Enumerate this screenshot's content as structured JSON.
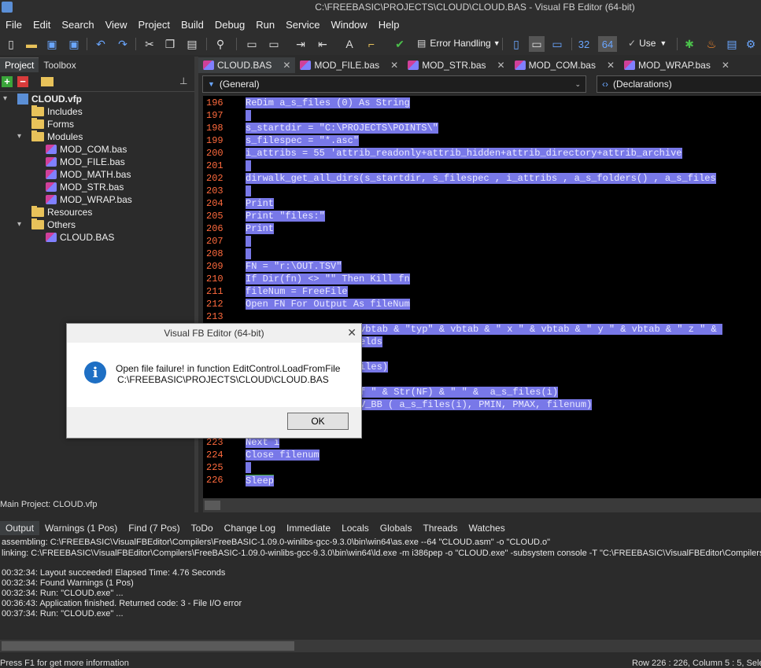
{
  "window": {
    "title": "C:\\FREEBASIC\\PROJECTS\\CLOUD\\CLOUD.BAS - Visual FB Editor (64-bit)"
  },
  "menu": [
    "File",
    "Edit",
    "Search",
    "View",
    "Project",
    "Build",
    "Debug",
    "Run",
    "Service",
    "Window",
    "Help"
  ],
  "toolbar": {
    "error_handling": "Error Handling",
    "n32": "32",
    "n64": "64",
    "use": "Use"
  },
  "left_tabs": [
    "Project",
    "Toolbox"
  ],
  "tree": {
    "root": "CLOUD.vfp",
    "includes": "Includes",
    "forms": "Forms",
    "modules": "Modules",
    "modules_items": [
      "MOD_COM.bas",
      "MOD_FILE.bas",
      "MOD_MATH.bas",
      "MOD_STR.bas",
      "MOD_WRAP.bas"
    ],
    "resources": "Resources",
    "others": "Others",
    "others_items": [
      "CLOUD.BAS"
    ]
  },
  "main_project": "Main Project: CLOUD.vfp",
  "editor_tabs": [
    "CLOUD.BAS",
    "MOD_FILE.bas",
    "MOD_STR.bas",
    "MOD_COM.bas",
    "MOD_WRAP.bas"
  ],
  "combo_left": "(General)",
  "combo_right": "(Declarations)",
  "code": [
    {
      "n": "196",
      "t": "ReDim a_s_files (0) As String"
    },
    {
      "n": "197",
      "t": " "
    },
    {
      "n": "198",
      "t": "s_startdir = \"C:\\PROJECTS\\POINTS\\\""
    },
    {
      "n": "199",
      "t": "s_filespec = \"*.asc\""
    },
    {
      "n": "200",
      "t": "i_attribs = 55 'attrib_readonly+attrib_hidden+attrib_directory+attrib_archive"
    },
    {
      "n": "201",
      "t": " "
    },
    {
      "n": "202",
      "t": "dirwalk_get_all_dirs(s_startdir, s_filespec , i_attribs , a_s_folders() , a_s_files"
    },
    {
      "n": "203",
      "t": " "
    },
    {
      "n": "204",
      "t": "Print"
    },
    {
      "n": "205",
      "t": "Print \"files:\""
    },
    {
      "n": "206",
      "t": "Print"
    },
    {
      "n": "207",
      "t": " "
    },
    {
      "n": "208",
      "t": " "
    },
    {
      "n": "209",
      "t": "FN = \"r:\\OUT.TSV\""
    },
    {
      "n": "210",
      "t": "If Dir(fn) <> \"\" Then Kill fn"
    },
    {
      "n": "211",
      "t": "fileNum = FreeFile"
    },
    {
      "n": "212",
      "t": "Open FN For Output As fileNum"
    },
    {
      "n": "213",
      "t": ""
    },
    {
      "n": "214",
      "t": "vbtab & \"typ\" & vbtab & \" x \" & vbtab & \" y \" & vbtab & \" z \" & "
    },
    {
      "n": "215",
      "t": "elds"
    },
    {
      "n": "216",
      "t": ""
    },
    {
      "n": "217",
      "t": "iles)"
    },
    {
      "n": "218",
      "t": ""
    },
    {
      "n": "219",
      "t": "f \" & Str(NF) & \" \" &  a_s_files(i)"
    },
    {
      "n": "220",
      "t": "V_BB ( a_s_files(i), PMIN, PMAX, filenum)"
    },
    {
      "n": "223",
      "t": "Next i"
    },
    {
      "n": "224",
      "t": "Close filenum"
    },
    {
      "n": "225",
      "t": " "
    },
    {
      "n": "226",
      "t": "Sleep"
    }
  ],
  "bottom_tabs": [
    "Output",
    "Warnings (1 Pos)",
    "Find (7 Pos)",
    "ToDo",
    "Change Log",
    "Immediate",
    "Locals",
    "Globals",
    "Threads",
    "Watches"
  ],
  "output_lines": [
    "assembling:   C:\\FREEBASIC\\VisualFBEditor\\Compilers\\FreeBASIC-1.09.0-winlibs-gcc-9.3.0\\bin\\win64\\as.exe --64 \"CLOUD.asm\" -o \"CLOUD.o\"",
    "linking:     C:\\FREEBASIC\\VisualFBEditor\\Compilers\\FreeBASIC-1.09.0-winlibs-gcc-9.3.0\\bin\\win64\\ld.exe -m i386pep -o \"CLOUD.exe\" -subsystem console -T \"C:\\FREEBASIC\\VisualFBEditor\\Compilers\\Fre",
    "",
    "00:32:34: Layout succeeded! Elapsed Time: 4.76 Seconds",
    "00:32:34: Found Warnings (1 Pos)",
    "00:32:34: Run: \"CLOUD.exe\"  ...",
    "00:36:43: Application finished. Returned code: 3 - File I/O error",
    "00:37:34: Run: \"CLOUD.exe\"  ..."
  ],
  "status_left": "Press F1 for get more information",
  "status_right": "Row 226 : 226, Column 5 : 5, Sele",
  "dialog": {
    "title": "Visual FB Editor (64-bit)",
    "message1": "Open file failure! in function EditControl.LoadFromFile",
    "message2": "C:\\FREEBASIC\\PROJECTS\\CLOUD\\CLOUD.BAS",
    "ok": "OK",
    "close": "✕"
  }
}
